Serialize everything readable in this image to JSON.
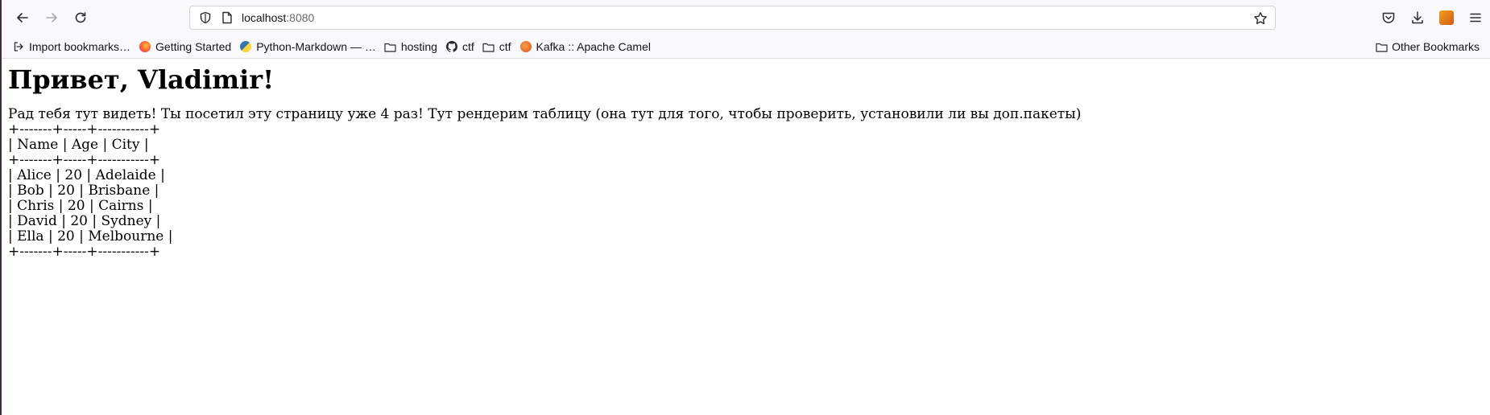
{
  "browser": {
    "url_host": "localhost",
    "url_port": ":8080",
    "bookmarks": [
      {
        "label": "Import bookmarks…",
        "icon": "import-icon"
      },
      {
        "label": "Getting Started",
        "icon": "firefox-icon"
      },
      {
        "label": "Python-Markdown — …",
        "icon": "python-icon"
      },
      {
        "label": "hosting",
        "icon": "folder-icon"
      },
      {
        "label": "ctf",
        "icon": "github-icon"
      },
      {
        "label": "ctf",
        "icon": "folder-icon"
      },
      {
        "label": "Kafka :: Apache Camel",
        "icon": "camel-icon"
      }
    ],
    "other_bookmarks": "Other Bookmarks"
  },
  "page": {
    "heading": "Привет, Vladimir!",
    "greeting": "Рад тебя тут видеть! Ты посетил эту страницу уже 4 раз! Тут рендерим таблицу (она тут для того, чтобы проверить, установили ли вы доп.пакеты)",
    "table_lines": [
      "+-------+-----+-----------+",
      "| Name | Age | City |",
      "+-------+-----+-----------+",
      "| Alice | 20 | Adelaide |",
      "| Bob | 20 | Brisbane |",
      "| Chris | 20 | Cairns |",
      "| David | 20 | Sydney |",
      "| Ella | 20 | Melbourne |",
      "+-------+-----+-----------+"
    ]
  }
}
